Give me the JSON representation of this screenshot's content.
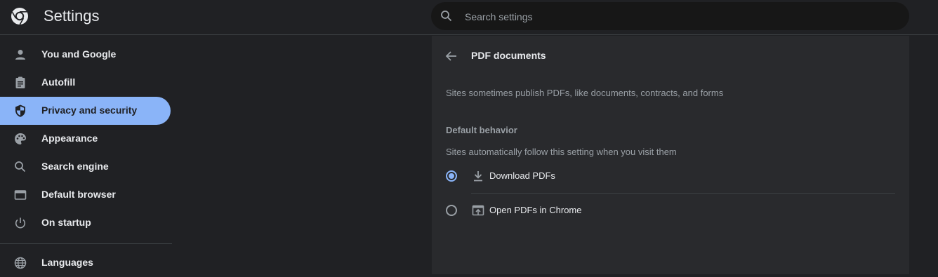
{
  "header": {
    "title": "Settings",
    "search_placeholder": "Search settings"
  },
  "sidebar": {
    "items": [
      {
        "label": "You and Google",
        "icon": "person-icon",
        "active": false
      },
      {
        "label": "Autofill",
        "icon": "clipboard-icon",
        "active": false
      },
      {
        "label": "Privacy and security",
        "icon": "shield-icon",
        "active": true
      },
      {
        "label": "Appearance",
        "icon": "palette-icon",
        "active": false
      },
      {
        "label": "Search engine",
        "icon": "search-icon",
        "active": false
      },
      {
        "label": "Default browser",
        "icon": "browser-window-icon",
        "active": false
      },
      {
        "label": "On startup",
        "icon": "power-icon",
        "active": false
      },
      {
        "label": "Languages",
        "icon": "globe-icon",
        "active": false
      }
    ]
  },
  "content": {
    "title": "PDF documents",
    "description": "Sites sometimes publish PDFs, like documents, contracts, and forms",
    "section_header": "Default behavior",
    "section_sub": "Sites automatically follow this setting when you visit them",
    "options": [
      {
        "label": "Download PDFs",
        "icon": "download-icon",
        "selected": true
      },
      {
        "label": "Open PDFs in Chrome",
        "icon": "open-in-browser-icon",
        "selected": false
      }
    ]
  },
  "colors": {
    "background": "#202124",
    "card": "#292a2d",
    "accent": "#8ab4f8",
    "text": "#e8eaed",
    "secondary_text": "#9aa0a6"
  }
}
